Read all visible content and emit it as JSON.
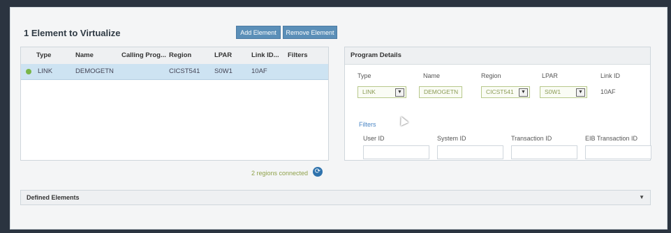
{
  "title": "1 Element to Virtualize",
  "toolbar": {
    "add_label": "Add Element",
    "remove_label": "Remove Element"
  },
  "grid": {
    "headers": [
      "Type",
      "Name",
      "Calling Prog...",
      "Region",
      "LPAR",
      "Link ID...",
      "Filters"
    ],
    "rows": [
      {
        "type": "LINK",
        "name": "DEMOGETN",
        "calling_prog": "",
        "region": "CICST541",
        "lpar": "S0W1",
        "link_id": "10AF",
        "filters": ""
      }
    ]
  },
  "status": {
    "text": "2 regions connected"
  },
  "details": {
    "title": "Program Details",
    "labels": {
      "type": "Type",
      "name": "Name",
      "region": "Region",
      "lpar": "LPAR",
      "link_id": "Link ID"
    },
    "values": {
      "type": "LINK",
      "name": "DEMOGETN",
      "region": "CICST541",
      "lpar": "S0W1",
      "link_id": "10AF"
    },
    "filters_label": "Filters",
    "filter_labels": {
      "user_id": "User ID",
      "system_id": "System ID",
      "transaction_id": "Transaction ID",
      "eib_transaction_id": "EIB Transaction ID"
    }
  },
  "defined": {
    "label": "Defined Elements"
  },
  "icons": {
    "refresh": "refresh-icon",
    "dropdown": "chevron-down-icon"
  },
  "colors": {
    "accent": "#5b8fb8",
    "selected_row": "#cde3f2",
    "status_green": "#7ab648"
  }
}
